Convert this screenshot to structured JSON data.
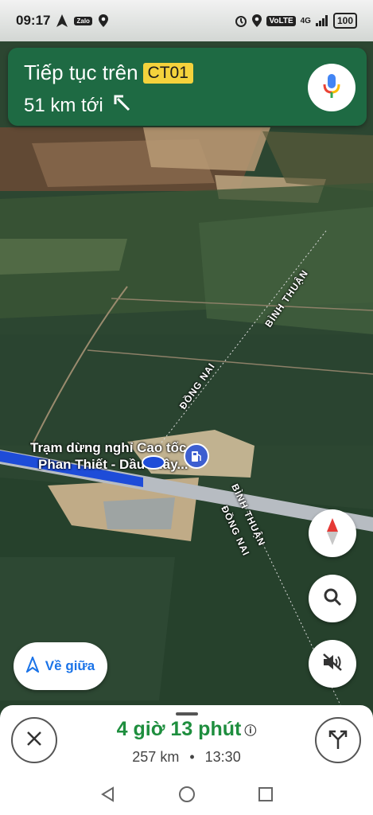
{
  "status_bar": {
    "time": "09:17",
    "zalo": "Zalo",
    "volte": "VoLTE",
    "network": "4G",
    "battery": "100"
  },
  "nav_banner": {
    "continue_text": "Tiếp tục trên",
    "road": "CT01",
    "distance_text": "51 km tới"
  },
  "map": {
    "region_labels": [
      "BÌNH THUẬN",
      "ĐỒNG NAI",
      "BÌNH THUẬN",
      "ĐỒNG NAI"
    ],
    "poi": {
      "line1": "Trạm dừng nghỉ Cao tốc",
      "line2": "Phan Thiết - Dầu Giây..."
    }
  },
  "buttons": {
    "recenter_label": "Về giữa"
  },
  "trip": {
    "eta_duration": "4 giờ 13 phút",
    "distance": "257 km",
    "separator": "•",
    "arrival_time": "13:30"
  },
  "colors": {
    "banner": "#1e6a43",
    "shield": "#f4d23c",
    "eta": "#1e8e3e",
    "route": "#1e4cd8",
    "accent": "#1a73e8"
  },
  "icons": [
    "navigation-arrow-icon",
    "zalo-icon",
    "location-icon",
    "alarm-icon",
    "signal-icon",
    "mic-icon",
    "turn-left-icon",
    "fuel-icon",
    "compass-icon",
    "search-icon",
    "mute-icon",
    "close-icon",
    "alt-routes-icon",
    "back-icon",
    "home-icon",
    "recents-icon"
  ]
}
